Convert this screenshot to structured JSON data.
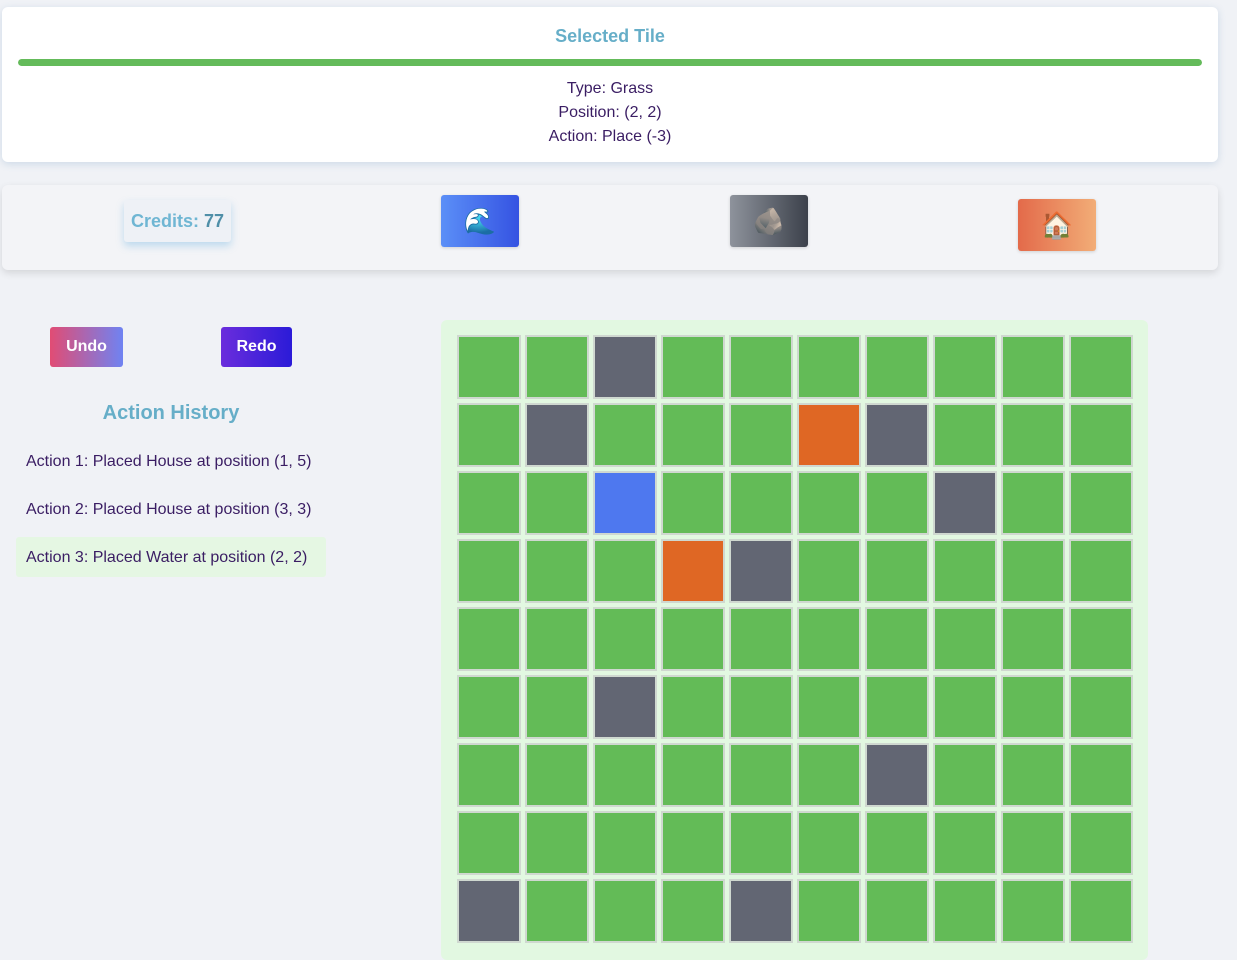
{
  "selected_tile": {
    "title": "Selected Tile",
    "progress": 1.0,
    "type_line": "Type: Grass",
    "position_line": "Position: (2, 2)",
    "action_line": "Action: Place (-3)"
  },
  "toolbar": {
    "credits_label": "Credits:",
    "credits_value": "77",
    "tools": [
      {
        "name": "water",
        "icon": "🌊"
      },
      {
        "name": "rock",
        "icon": "🪨"
      },
      {
        "name": "house",
        "icon": "🏠"
      }
    ]
  },
  "controls": {
    "undo_label": "Undo",
    "redo_label": "Redo"
  },
  "history": {
    "title": "Action History",
    "items": [
      "Action 1: Placed House at position (1, 5)",
      "Action 2: Placed House at position (3, 3)",
      "Action 3: Placed Water at position (2, 2)"
    ],
    "current_index": 2
  },
  "colors": {
    "grass": "#63bb57",
    "rock": "#626673",
    "water": "#4e78ef",
    "house": "#df6724"
  },
  "grid": {
    "columns": 10,
    "rows": [
      [
        "grass",
        "grass",
        "rock",
        "grass",
        "grass",
        "grass",
        "grass",
        "grass",
        "grass",
        "grass"
      ],
      [
        "grass",
        "rock",
        "grass",
        "grass",
        "grass",
        "house",
        "rock",
        "grass",
        "grass",
        "grass"
      ],
      [
        "grass",
        "grass",
        "water",
        "grass",
        "grass",
        "grass",
        "grass",
        "rock",
        "grass",
        "grass"
      ],
      [
        "grass",
        "grass",
        "grass",
        "house",
        "rock",
        "grass",
        "grass",
        "grass",
        "grass",
        "grass"
      ],
      [
        "grass",
        "grass",
        "grass",
        "grass",
        "grass",
        "grass",
        "grass",
        "grass",
        "grass",
        "grass"
      ],
      [
        "grass",
        "grass",
        "rock",
        "grass",
        "grass",
        "grass",
        "grass",
        "grass",
        "grass",
        "grass"
      ],
      [
        "grass",
        "grass",
        "grass",
        "grass",
        "grass",
        "grass",
        "rock",
        "grass",
        "grass",
        "grass"
      ],
      [
        "grass",
        "grass",
        "grass",
        "grass",
        "grass",
        "grass",
        "grass",
        "grass",
        "grass",
        "grass"
      ],
      [
        "rock",
        "grass",
        "grass",
        "grass",
        "rock",
        "grass",
        "grass",
        "grass",
        "grass",
        "grass"
      ]
    ]
  }
}
